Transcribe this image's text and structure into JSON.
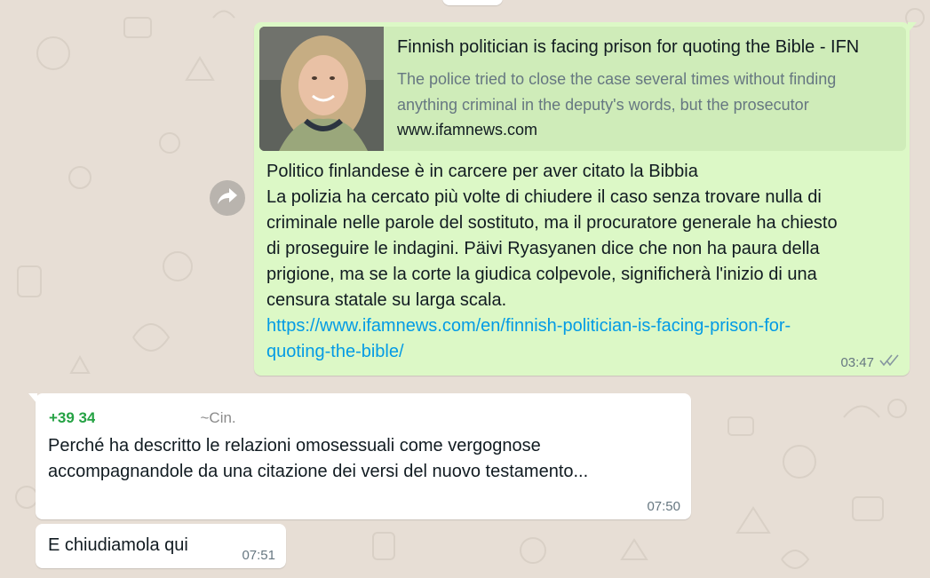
{
  "chat": {
    "outgoing": {
      "link_preview": {
        "title": "Finnish politician is facing prison for quoting the Bible - IFN",
        "description": "The police tried to close the case several times without finding anything criminal in the deputy's words, but the prosecutor",
        "domain": "www.ifamnews.com",
        "thumbnail_icon": "woman-portrait-thumbnail"
      },
      "text_lines": [
        "Politico finlandese è in carcere per aver citato la Bibbia",
        "La polizia ha cercato più volte di chiudere il caso senza trovare nulla di",
        "criminale nelle parole del sostituto, ma il procuratore generale ha chiesto",
        "di proseguire le indagini. Päivi Ryasyanen dice che non ha paura della",
        "prigione, ma se la corte la giudica colpevole, significherà l'inizio di una",
        "censura statale su larga scala."
      ],
      "link_lines": [
        "https://www.ifamnews.com/en/finnish-politician-is-facing-prison-for-",
        "quoting-the-bible/"
      ],
      "time": "03:47",
      "status_icon": "double-check-icon"
    },
    "forward_icon": "forward-arrow-icon",
    "incoming_1": {
      "sender_phone": "+39 34",
      "sender_name": "~Cin.",
      "text_lines": [
        "Perché ha descritto le relazioni omosessuali come vergognose",
        "accompagnandole da una citazione dei versi del nuovo testamento..."
      ],
      "time": "07:50"
    },
    "incoming_2": {
      "text": "E chiudiamola qui",
      "time": "07:51"
    }
  },
  "colors": {
    "background": "#e7ded5",
    "outgoing_bubble": "#dcf8c6",
    "link_preview_bg": "#cfecb9",
    "incoming_bubble": "#ffffff",
    "link": "#039be5",
    "sender_phone": "#25a244",
    "meta_text": "#667781"
  }
}
